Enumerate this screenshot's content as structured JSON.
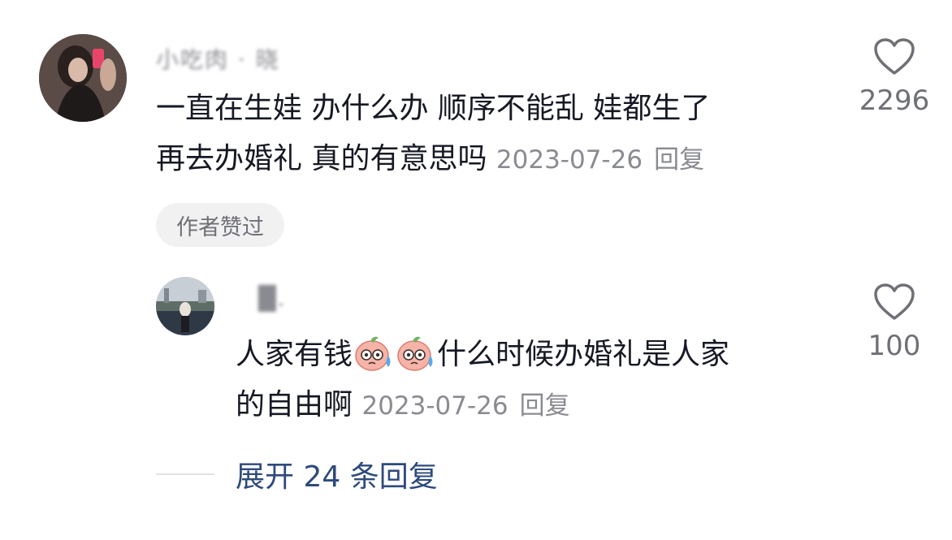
{
  "comments": [
    {
      "username": "小吃肉 · 晓",
      "text_line1": "一直在生娃 办什么办  顺序不能乱 娃都生了",
      "text_line2": "再去办婚礼 真的有意思吗",
      "date": "2023-07-26",
      "reply_label": "回复",
      "like_count": "2296",
      "badge": "作者赞过",
      "avatar_icon": "user-avatar-photo"
    },
    {
      "username": "█.",
      "text_part1": "人家有钱",
      "text_part2": "什么时候办婚礼是人家",
      "text_line2": "的自由啊",
      "emoji_name": "sweating-peach-emoji",
      "date": "2023-07-26",
      "reply_label": "回复",
      "like_count": "100",
      "avatar_icon": "user-avatar-photo"
    }
  ],
  "expand_replies": {
    "label": "展开 24 条回复"
  },
  "colors": {
    "text_primary": "#161823",
    "text_secondary": "#8a8b91",
    "link_blue": "#2e4a7c",
    "badge_bg": "#f1f1f2"
  }
}
